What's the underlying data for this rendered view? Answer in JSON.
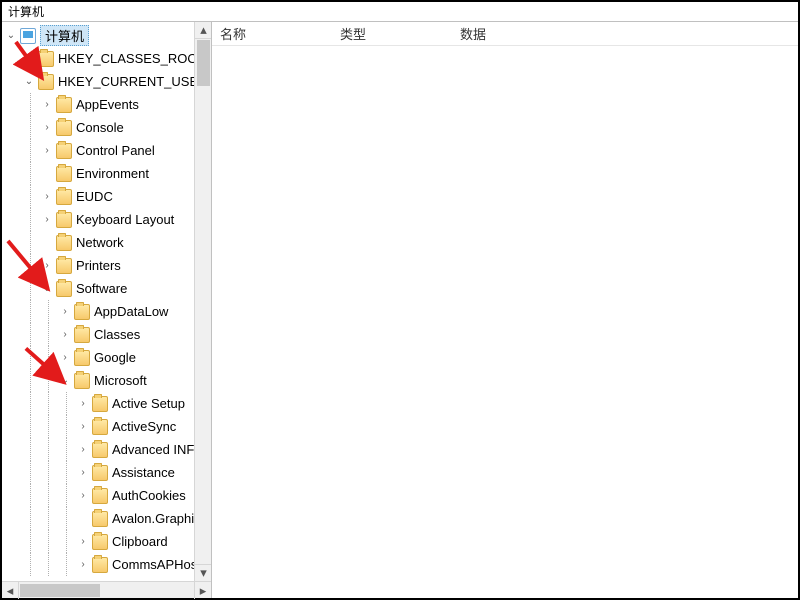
{
  "window": {
    "title": "计算机"
  },
  "columns": {
    "name": "名称",
    "type": "类型",
    "data": "数据"
  },
  "tree": {
    "root": {
      "label": "计算机",
      "state": "expanded",
      "icon": "pc",
      "selected": true,
      "children": [
        {
          "label": "HKEY_CLASSES_ROOT",
          "state": "collapsed",
          "icon": "folder"
        },
        {
          "label": "HKEY_CURRENT_USER",
          "state": "expanded",
          "icon": "folder",
          "children": [
            {
              "label": "AppEvents",
              "state": "collapsed",
              "icon": "folder"
            },
            {
              "label": "Console",
              "state": "collapsed",
              "icon": "folder"
            },
            {
              "label": "Control Panel",
              "state": "collapsed",
              "icon": "folder"
            },
            {
              "label": "Environment",
              "state": "leaf",
              "icon": "folder"
            },
            {
              "label": "EUDC",
              "state": "collapsed",
              "icon": "folder"
            },
            {
              "label": "Keyboard Layout",
              "state": "collapsed",
              "icon": "folder"
            },
            {
              "label": "Network",
              "state": "leaf",
              "icon": "folder"
            },
            {
              "label": "Printers",
              "state": "collapsed",
              "icon": "folder"
            },
            {
              "label": "Software",
              "state": "expanded",
              "icon": "folder",
              "children": [
                {
                  "label": "AppDataLow",
                  "state": "collapsed",
                  "icon": "folder"
                },
                {
                  "label": "Classes",
                  "state": "collapsed",
                  "icon": "folder"
                },
                {
                  "label": "Google",
                  "state": "collapsed",
                  "icon": "folder"
                },
                {
                  "label": "Microsoft",
                  "state": "expanded",
                  "icon": "folder",
                  "children": [
                    {
                      "label": "Active Setup",
                      "state": "collapsed",
                      "icon": "folder"
                    },
                    {
                      "label": "ActiveSync",
                      "state": "collapsed",
                      "icon": "folder"
                    },
                    {
                      "label": "Advanced INF S",
                      "state": "collapsed",
                      "icon": "folder"
                    },
                    {
                      "label": "Assistance",
                      "state": "collapsed",
                      "icon": "folder"
                    },
                    {
                      "label": "AuthCookies",
                      "state": "collapsed",
                      "icon": "folder"
                    },
                    {
                      "label": "Avalon.Graphics",
                      "state": "leaf",
                      "icon": "folder"
                    },
                    {
                      "label": "Clipboard",
                      "state": "collapsed",
                      "icon": "folder"
                    },
                    {
                      "label": "CommsAPHost",
                      "state": "collapsed",
                      "icon": "folder"
                    }
                  ]
                }
              ]
            }
          ]
        }
      ]
    }
  },
  "annotations": {
    "arrows": [
      {
        "target": "HKEY_CURRENT_USER"
      },
      {
        "target": "Software"
      },
      {
        "target": "Microsoft"
      }
    ]
  }
}
